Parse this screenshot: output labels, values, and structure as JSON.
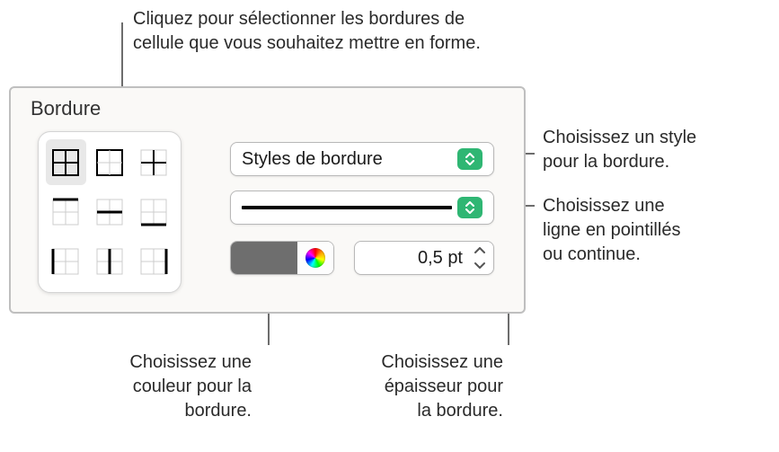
{
  "callouts": {
    "top": "Cliquez pour sélectionner les bordures de\ncellule que vous souhaitez mettre en forme.",
    "style": "Choisissez un style\npour la bordure.",
    "line": "Choisissez une\nligne en pointillés\nou continue.",
    "color": "Choisissez une\ncouleur pour la\nbordure.",
    "thickness": "Choisissez une\népaisseur pour\nla bordure."
  },
  "panel": {
    "section_label": "Bordure",
    "style_label": "Styles de bordure",
    "thickness_value": "0,5 pt"
  },
  "border_grid": {
    "items": [
      {
        "name": "all",
        "selected": true
      },
      {
        "name": "outside",
        "selected": false
      },
      {
        "name": "inside",
        "selected": false
      },
      {
        "name": "top",
        "selected": false
      },
      {
        "name": "horizontal-middle",
        "selected": false
      },
      {
        "name": "bottom",
        "selected": false
      },
      {
        "name": "left",
        "selected": false
      },
      {
        "name": "vertical-middle",
        "selected": false
      },
      {
        "name": "right",
        "selected": false
      }
    ]
  },
  "colors": {
    "swatch": "#6e6e6e",
    "accent": "#2fb673"
  }
}
